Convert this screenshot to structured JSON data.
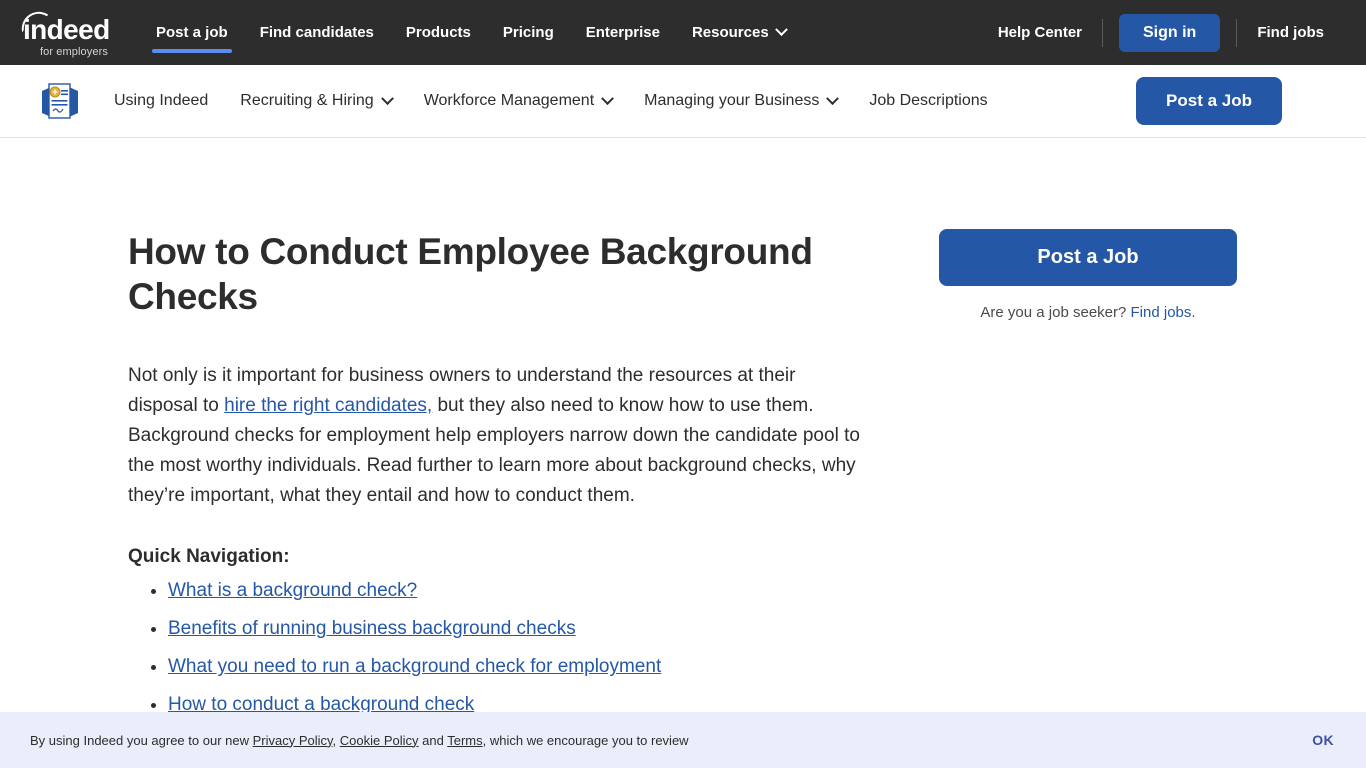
{
  "top_nav": {
    "logo": {
      "word": "indeed",
      "tagline": "for employers",
      "icon": "indeed-logo-icon"
    },
    "items": [
      {
        "label": "Post a job",
        "active": true,
        "has_caret": false
      },
      {
        "label": "Find candidates",
        "active": false,
        "has_caret": false
      },
      {
        "label": "Products",
        "active": false,
        "has_caret": false
      },
      {
        "label": "Pricing",
        "active": false,
        "has_caret": false
      },
      {
        "label": "Enterprise",
        "active": false,
        "has_caret": false
      },
      {
        "label": "Resources",
        "active": false,
        "has_caret": true
      }
    ],
    "help_center": "Help Center",
    "sign_in": "Sign in",
    "find_jobs": "Find jobs",
    "accent_color": "#2557a7",
    "active_underline_color": "#5b8def",
    "background_color": "#2d2d2d"
  },
  "sub_nav": {
    "icon": "certificate-document-icon",
    "items": [
      {
        "label": "Using Indeed",
        "has_caret": false
      },
      {
        "label": "Recruiting & Hiring",
        "has_caret": true
      },
      {
        "label": "Workforce Management",
        "has_caret": true
      },
      {
        "label": "Managing your Business",
        "has_caret": true
      },
      {
        "label": "Job Descriptions",
        "has_caret": false
      }
    ],
    "post_a_job": "Post a Job"
  },
  "article": {
    "title": "How to Conduct Employee Background Checks",
    "intro_part_1": "Not only is it important for business owners to understand the resources at their disposal to ",
    "intro_link": "hire the right candidates,",
    "intro_part_2": " but they also need to know how to use them. Background checks for employment help employers narrow down the candidate pool to the most worthy individuals. Read further to learn more about background checks, why they’re important, what they entail and how to conduct them.",
    "quick_nav_heading": "Quick Navigation:",
    "quick_nav_items": [
      "What is a background check?",
      "Benefits of running business background checks",
      "What you need to run a background check for employment",
      "How to conduct a background check"
    ]
  },
  "rail": {
    "post_a_job": "Post a Job",
    "seeker_prompt": "Are you a job seeker? ",
    "seeker_link": "Find jobs",
    "seeker_period": "."
  },
  "cookie_banner": {
    "lead": "By using Indeed you agree to our new ",
    "privacy_policy": "Privacy Policy",
    "comma": ", ",
    "cookie_policy": "Cookie Policy",
    "and": " and ",
    "terms": "Terms",
    "tail": ", which we encourage you to review",
    "ok": "OK",
    "background_color": "#eaeefb"
  }
}
